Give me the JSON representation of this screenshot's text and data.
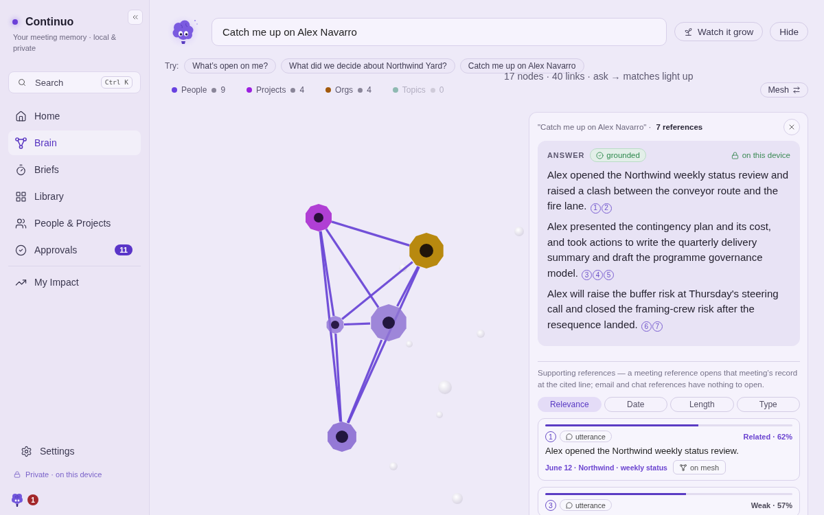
{
  "sidebar": {
    "brand": "Continuo",
    "tagline": "Your meeting memory · local & private",
    "search": {
      "placeholder": "Search",
      "shortcut": "Ctrl K"
    },
    "nav": [
      {
        "label": "Home",
        "selected": false
      },
      {
        "label": "Brain",
        "selected": true
      },
      {
        "label": "Briefs",
        "selected": false
      },
      {
        "label": "Library",
        "selected": false
      },
      {
        "label": "People & Projects",
        "selected": false
      },
      {
        "label": "Approvals",
        "selected": false,
        "badge": "11"
      }
    ],
    "nav_more": [
      {
        "label": "My Impact",
        "selected": false
      }
    ],
    "settings": "Settings",
    "privacy": "Private · on this device",
    "notifications": "1"
  },
  "ask": {
    "value": "Catch me up on Alex Navarro",
    "actions": [
      {
        "label": "Watch it grow"
      },
      {
        "label": "Hide"
      }
    ]
  },
  "suggestions": {
    "label": "Try:",
    "items": [
      "What’s open on me?",
      "What did we decide about Northwind Yard?",
      "Catch me up on Alex Navarro"
    ]
  },
  "legend": [
    {
      "label": "People",
      "count": "9",
      "color": "#6842e0",
      "disabled": false
    },
    {
      "label": "Projects",
      "count": "4",
      "color": "#9c1fe0",
      "disabled": false
    },
    {
      "label": "Orgs",
      "count": "4",
      "color": "#a35a0c",
      "disabled": false
    },
    {
      "label": "Topics",
      "count": "0",
      "color": "#8fbab2",
      "disabled": true
    }
  ],
  "graph_stats": "17 nodes · 40 links · ask → matches light up",
  "layout_toggle": "Mesh",
  "answer_panel": {
    "query": "\"Catch me up on Alex Navarro\" ·",
    "count": "7 references",
    "answer": {
      "heading": "ANSWER",
      "badge": "grounded",
      "privacy": "on this device",
      "paragraphs": [
        {
          "text": "Alex opened the Northwind weekly status review and raised a clash between the conveyor route and the fire lane.",
          "citations": [
            "1",
            "2"
          ]
        },
        {
          "text": "Alex presented the contingency plan and its cost, and took actions to write the quarterly delivery summary and draft the programme governance model.",
          "citations": [
            "3",
            "4",
            "5"
          ]
        },
        {
          "text": "Alex will raise the buffer risk at Thursday's steering call and closed the framing-crew risk after the resequence landed.",
          "citations": [
            "6",
            "7"
          ]
        }
      ]
    },
    "note": "Supporting references — a meeting reference opens that meeting’s record at the cited line; email and chat references have nothing to open.",
    "sort_tabs": [
      {
        "label": "Relevance",
        "selected": true
      },
      {
        "label": "Date",
        "selected": false
      },
      {
        "label": "Length",
        "selected": false
      },
      {
        "label": "Type",
        "selected": false
      }
    ],
    "references": [
      {
        "number": "1",
        "type": "utterance",
        "strength": "Related · 62%",
        "kind": "related",
        "level": 0.62,
        "text": "Alex opened the Northwind weekly status review.",
        "meta": "June 12 · Northwind · weekly status",
        "action": "on mesh"
      },
      {
        "number": "3",
        "type": "utterance",
        "strength": "Weak · 57%",
        "kind": "weak",
        "level": 0.57
      }
    ]
  }
}
